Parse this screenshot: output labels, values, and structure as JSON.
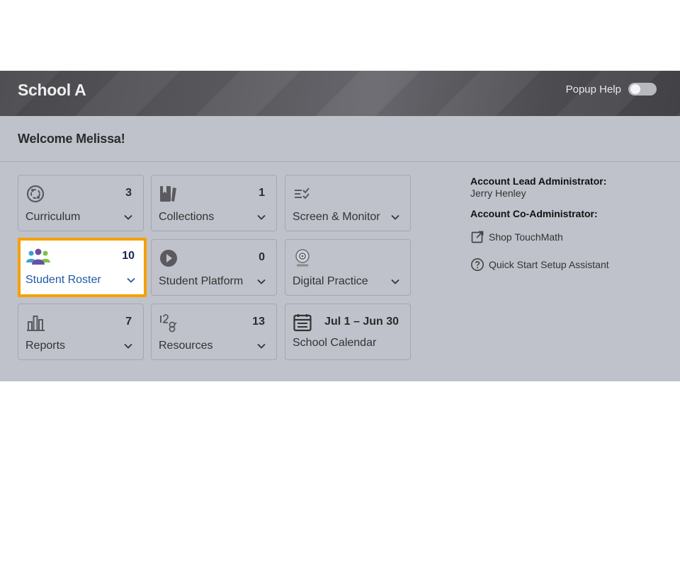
{
  "header": {
    "school_name": "School A",
    "popup_help_label": "Popup Help"
  },
  "welcome": "Welcome Melissa!",
  "tiles": [
    {
      "label": "Curriculum",
      "count": "3",
      "icon": "curriculum-icon"
    },
    {
      "label": "Collections",
      "count": "1",
      "icon": "collections-icon"
    },
    {
      "label": "Screen & Monitor",
      "count": "",
      "icon": "screen-monitor-icon"
    },
    {
      "label": "Student Roster",
      "count": "10",
      "icon": "students-icon"
    },
    {
      "label": "Student Platform",
      "count": "0",
      "icon": "play-icon"
    },
    {
      "label": "Digital Practice",
      "count": "",
      "icon": "digital-practice-icon"
    },
    {
      "label": "Reports",
      "count": "7",
      "icon": "bar-chart-icon"
    },
    {
      "label": "Resources",
      "count": "13",
      "icon": "resources-icon"
    },
    {
      "label": "School Calendar",
      "date_range": "Jul 1 – Jun 30",
      "icon": "calendar-icon"
    }
  ],
  "account": {
    "lead_admin_label": "Account Lead Administrator:",
    "lead_admin_name": "Jerry Henley",
    "co_admin_label": "Account Co-Administrator:"
  },
  "links": {
    "shop": "Shop TouchMath",
    "quick_start": "Quick Start Setup Assistant"
  },
  "colors": {
    "active_border": "#f5a000",
    "active_label": "#1f5aa8",
    "panel_bg": "#bfc2cb"
  }
}
